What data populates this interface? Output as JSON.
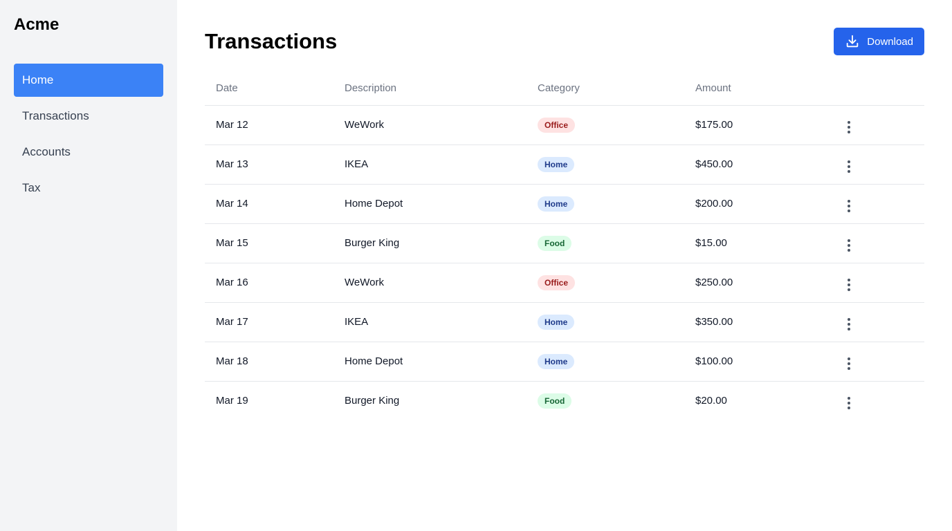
{
  "sidebar": {
    "brand": "Acme",
    "items": [
      {
        "label": "Home",
        "active": true
      },
      {
        "label": "Transactions",
        "active": false
      },
      {
        "label": "Accounts",
        "active": false
      },
      {
        "label": "Tax",
        "active": false
      }
    ]
  },
  "header": {
    "title": "Transactions",
    "download_label": "Download"
  },
  "table": {
    "columns": [
      "Date",
      "Description",
      "Category",
      "Amount"
    ],
    "rows": [
      {
        "date": "Mar 12",
        "description": "WeWork",
        "category": "Office",
        "amount": "$175.00"
      },
      {
        "date": "Mar 13",
        "description": "IKEA",
        "category": "Home",
        "amount": "$450.00"
      },
      {
        "date": "Mar 14",
        "description": "Home Depot",
        "category": "Home",
        "amount": "$200.00"
      },
      {
        "date": "Mar 15",
        "description": "Burger King",
        "category": "Food",
        "amount": "$15.00"
      },
      {
        "date": "Mar 16",
        "description": "WeWork",
        "category": "Office",
        "amount": "$250.00"
      },
      {
        "date": "Mar 17",
        "description": "IKEA",
        "category": "Home",
        "amount": "$350.00"
      },
      {
        "date": "Mar 18",
        "description": "Home Depot",
        "category": "Home",
        "amount": "$100.00"
      },
      {
        "date": "Mar 19",
        "description": "Burger King",
        "category": "Food",
        "amount": "$20.00"
      }
    ]
  },
  "icons": {
    "download": "download-icon",
    "row_menu": "more-vertical-icon"
  },
  "colors": {
    "accent": "#3b82f6",
    "button": "#2563eb",
    "office_badge_bg": "#fee2e2",
    "office_badge_text": "#991b1b",
    "home_badge_bg": "#dbeafe",
    "home_badge_text": "#1e3a8a",
    "food_badge_bg": "#dcfce7",
    "food_badge_text": "#166534"
  }
}
